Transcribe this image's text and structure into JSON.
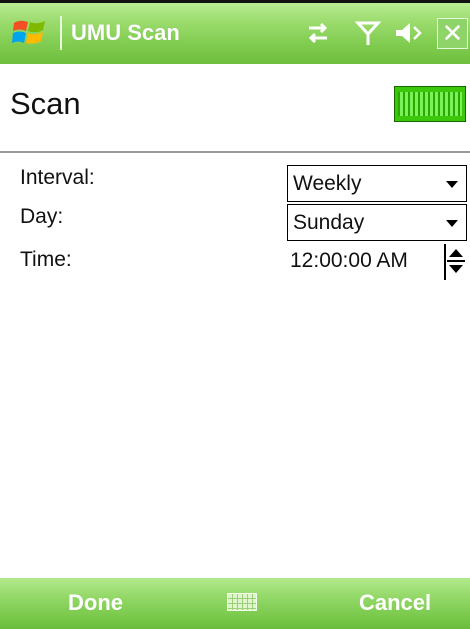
{
  "titlebar": {
    "app_title": "UMU Scan",
    "start_icon": "windows-flag-icon",
    "connectivity_icon": "connectivity-arrows-icon",
    "signal_icon": "antenna-signal-icon",
    "volume_icon": "speaker-icon",
    "close_glyph": "✕"
  },
  "header": {
    "title": "Scan",
    "battery_icon": "battery-full-icon"
  },
  "form": {
    "interval": {
      "label": "Interval:",
      "value": "Weekly"
    },
    "day": {
      "label": "Day:",
      "value": "Sunday"
    },
    "time": {
      "label": "Time:",
      "value": "12:00:00 AM"
    }
  },
  "menubar": {
    "left_label": "Done",
    "right_label": "Cancel",
    "sip_icon": "keyboard-icon"
  },
  "colors": {
    "titlebar_green": "#7fcb4f",
    "menubar_green": "#7ac94c",
    "battery_green": "#3cc70a"
  }
}
